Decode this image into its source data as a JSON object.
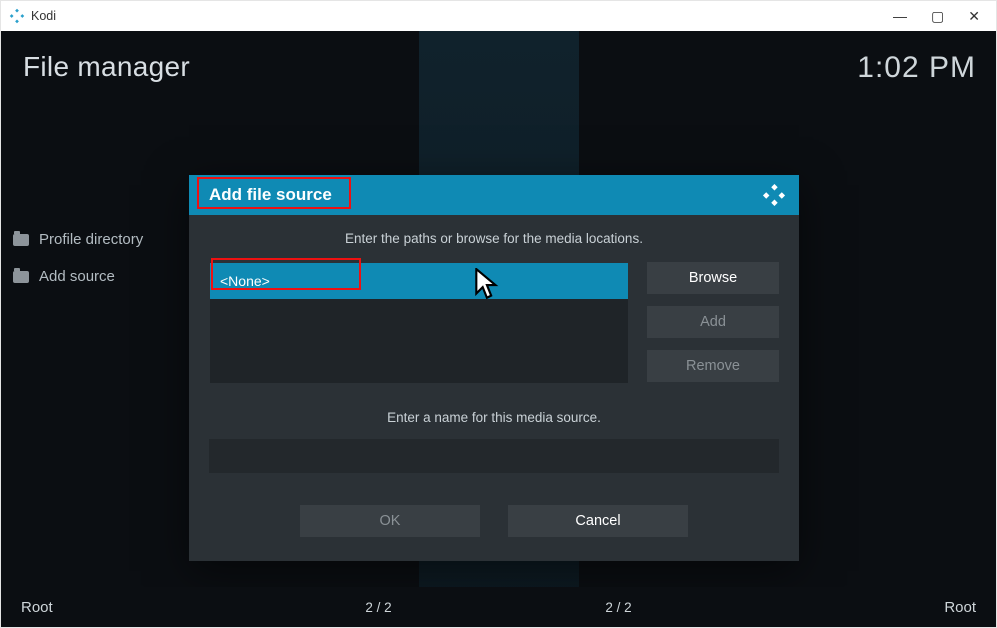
{
  "window": {
    "title": "Kodi"
  },
  "app": {
    "page_title": "File manager",
    "clock": "1:02 PM"
  },
  "sidebar": {
    "items": [
      {
        "label": "Profile directory"
      },
      {
        "label": "Add source"
      }
    ]
  },
  "status": {
    "left_root": "Root",
    "right_root": "Root",
    "pager_left": "2 / 2",
    "pager_right": "2 / 2"
  },
  "dialog": {
    "title": "Add file source",
    "paths_hint": "Enter the paths or browse for the media locations.",
    "path_value": "<None>",
    "browse_label": "Browse",
    "add_label": "Add",
    "remove_label": "Remove",
    "name_hint": "Enter a name for this media source.",
    "name_value": "",
    "ok_label": "OK",
    "cancel_label": "Cancel"
  }
}
